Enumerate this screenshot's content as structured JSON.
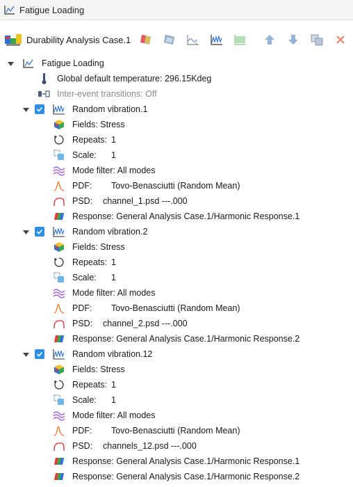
{
  "panel": {
    "title": "Fatigue Loading"
  },
  "toolbar": {
    "case_label": "Durability Analysis Case.1",
    "buttons": [
      "add-load-icon",
      "add-schedule-icon",
      "add-time-history-icon",
      "add-random-vibration-icon",
      "add-sine-sweep-icon",
      "move-up-icon",
      "move-down-icon",
      "copy-icon",
      "delete-icon"
    ]
  },
  "tree": {
    "root": {
      "label": "Fatigue Loading"
    },
    "global_temp": {
      "label": "Global default temperature: 296.15Kdeg"
    },
    "inter_event": {
      "label": "Inter-event transitions: Off"
    },
    "events": [
      {
        "name": "Random vibration.1",
        "fields": "Fields: Stress",
        "repeats_label": "Repeats:",
        "repeats_value": "1",
        "scale_label": "Scale:",
        "scale_value": "1",
        "mode_filter": "Mode filter: All modes",
        "pdf_label": "PDF:",
        "pdf_value": "Tovo-Benasciutti (Random Mean)",
        "psd_label": "PSD:",
        "psd_value": "channel_1.psd ---.000",
        "responses": [
          "Response: General Analysis Case.1/Harmonic Response.1"
        ]
      },
      {
        "name": "Random vibration.2",
        "fields": "Fields: Stress",
        "repeats_label": "Repeats:",
        "repeats_value": "1",
        "scale_label": "Scale:",
        "scale_value": "1",
        "mode_filter": "Mode filter: All modes",
        "pdf_label": "PDF:",
        "pdf_value": "Tovo-Benasciutti (Random Mean)",
        "psd_label": "PSD:",
        "psd_value": "channel_2.psd ---.000",
        "responses": [
          "Response: General Analysis Case.1/Harmonic Response.2"
        ]
      },
      {
        "name": "Random vibration.12",
        "fields": "Fields: Stress",
        "repeats_label": "Repeats:",
        "repeats_value": "1",
        "scale_label": "Scale:",
        "scale_value": "1",
        "mode_filter": "Mode filter: All modes",
        "pdf_label": "PDF:",
        "pdf_value": "Tovo-Benasciutti (Random Mean)",
        "psd_label": "PSD:",
        "psd_value": "channels_12.psd ---.000",
        "responses": [
          "Response: General Analysis Case.1/Harmonic Response.1",
          "Response: General Analysis Case.1/Harmonic Response.2"
        ]
      }
    ]
  },
  "colors": {
    "accent": "#2f8ee6",
    "muted": "#8a8a8a",
    "psd_red": "#d42a2a",
    "pdf_orange": "#e8742c",
    "mode_purple": "#9a4fd1"
  }
}
